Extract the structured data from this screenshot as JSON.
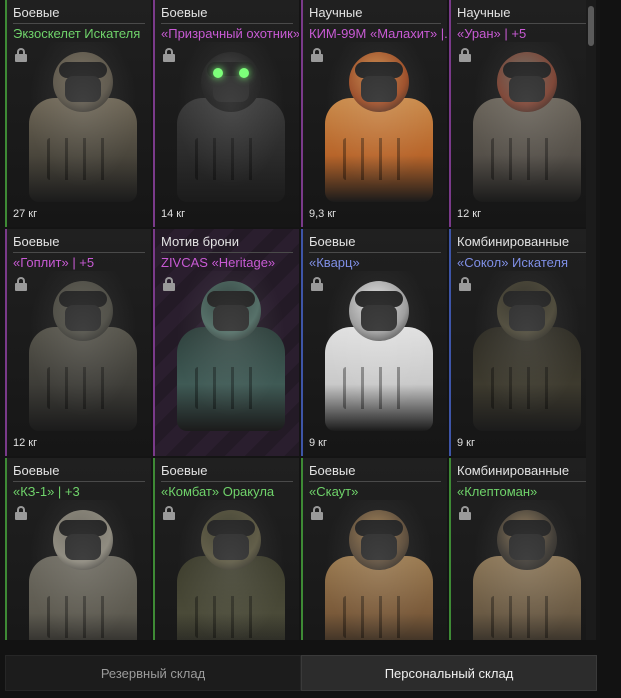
{
  "stash": {
    "items": [
      {
        "category": "Боевые",
        "name": "Экзоскелет Искателя",
        "weight": "27 кг",
        "icon": "exoskeleton-armor",
        "rarity": "green"
      },
      {
        "category": "Боевые",
        "name": "«Призрачный охотник»",
        "weight": "14 кг",
        "icon": "ghost-hunter-armor",
        "rarity": "purple"
      },
      {
        "category": "Научные",
        "name": "КИМ-99М «Малахит» |...",
        "weight": "9,3 кг",
        "icon": "scientific-suit-orange",
        "rarity": "purple"
      },
      {
        "category": "Научные",
        "name": "«Уран» | +5",
        "weight": "12 кг",
        "icon": "scientific-suit-camo",
        "rarity": "purple"
      },
      {
        "category": "Боевые",
        "name": "«Гоплит» | +5",
        "weight": "12 кг",
        "icon": "hoplite-armor",
        "rarity": "purple"
      },
      {
        "category": "Мотив брони",
        "name": "ZIVCAS «Heritage»",
        "weight": "",
        "icon": "armor-motif-heritage",
        "rarity": "purple"
      },
      {
        "category": "Боевые",
        "name": "«Кварц»",
        "weight": "9 кг",
        "icon": "quartz-winter-armor",
        "rarity": "blue"
      },
      {
        "category": "Комбинированные",
        "name": "«Сокол» Искателя",
        "weight": "9 кг",
        "icon": "falcon-armor",
        "rarity": "blue"
      },
      {
        "category": "Боевые",
        "name": "«КЗ-1» | +3",
        "weight": "",
        "icon": "kz1-hooded-armor",
        "rarity": "green"
      },
      {
        "category": "Боевые",
        "name": "«Комбат» Оракула",
        "weight": "",
        "icon": "combat-armor",
        "rarity": "green"
      },
      {
        "category": "Боевые",
        "name": "«Скаут»",
        "weight": "",
        "icon": "scout-armor",
        "rarity": "green"
      },
      {
        "category": "Комбинированные",
        "name": "«Клептоман»",
        "weight": "",
        "icon": "kleptoman-armor",
        "rarity": "green"
      }
    ]
  },
  "colors": {
    "rarity_green": "#6fd36a",
    "rarity_blue": "#7f8fe6",
    "rarity_purple": "#c85ad4"
  },
  "tabs": [
    {
      "label": "Резервный склад",
      "active": false
    },
    {
      "label": "Персональный склад",
      "active": true
    }
  ]
}
